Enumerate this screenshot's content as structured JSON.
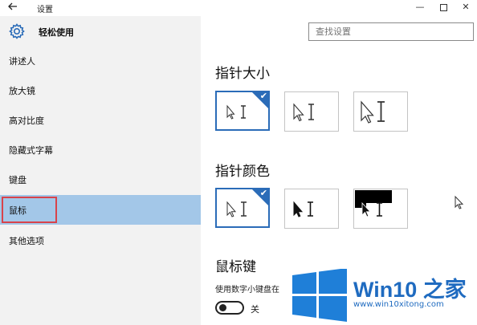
{
  "window": {
    "title": "设置",
    "back_icon": "arrow-left-icon",
    "minimize": "—",
    "close": "✕"
  },
  "sidebar": {
    "brand": "轻松使用",
    "brand_icon": "gear-icon",
    "items": [
      {
        "label": "讲述人"
      },
      {
        "label": "放大镜"
      },
      {
        "label": "高对比度"
      },
      {
        "label": "隐藏式字幕"
      },
      {
        "label": "键盘"
      },
      {
        "label": "鼠标",
        "active": true
      },
      {
        "label": "其他选项"
      }
    ]
  },
  "search": {
    "placeholder": "查找设置"
  },
  "main": {
    "pointer_size": {
      "title": "指针大小",
      "options": [
        {
          "name": "small",
          "selected": true
        },
        {
          "name": "medium",
          "selected": false
        },
        {
          "name": "large",
          "selected": false
        }
      ]
    },
    "pointer_color": {
      "title": "指针颜色",
      "options": [
        {
          "name": "white",
          "selected": true
        },
        {
          "name": "black",
          "selected": false
        },
        {
          "name": "inverted",
          "selected": false
        }
      ]
    },
    "mouse_keys": {
      "title": "鼠标键",
      "description": "使用数字小键盘在",
      "toggle_state": "关",
      "toggle_on": false
    }
  },
  "colors": {
    "accent": "#2b6cb8",
    "active_nav": "#a3c7e8",
    "sidebar_bg": "#f2f2f2",
    "highlight_outline": "#d8434b"
  },
  "watermark": {
    "title": "Win10 之家",
    "url": "www.win10xitong.com"
  }
}
